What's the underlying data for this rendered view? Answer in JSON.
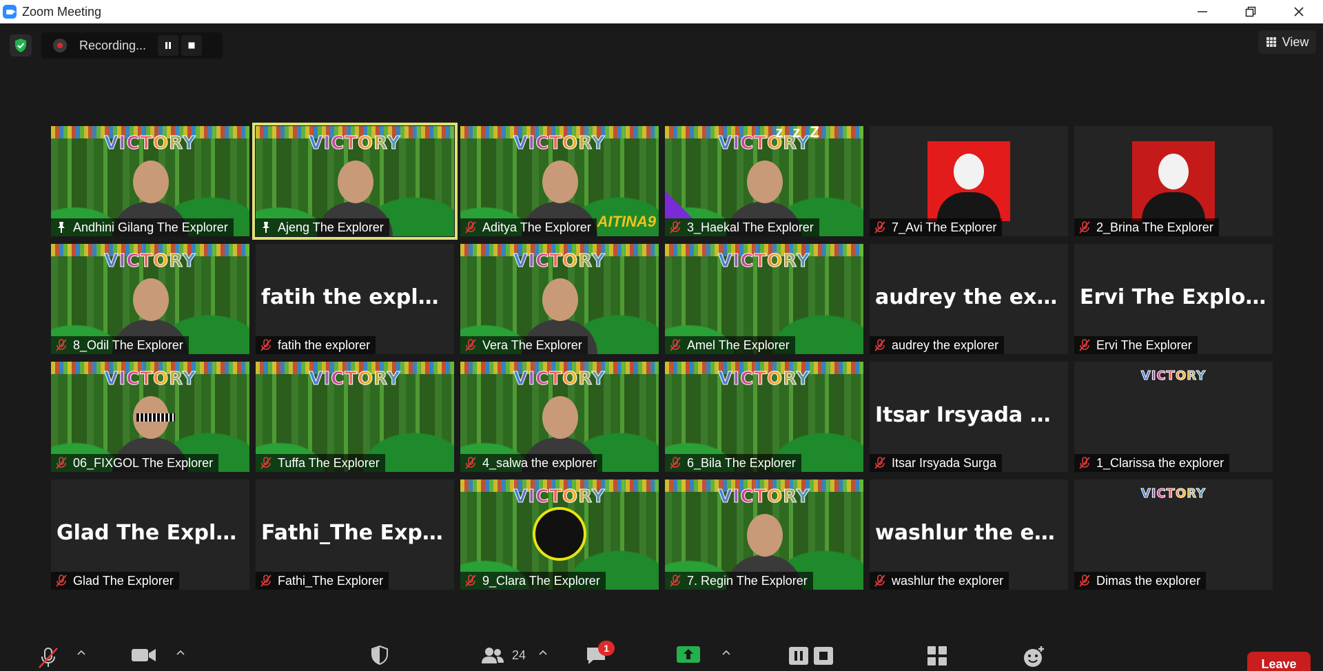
{
  "window": {
    "title": "Zoom Meeting",
    "minimize": "—",
    "restore": "❐",
    "close": "✕"
  },
  "recording": {
    "label": "Recording...",
    "pause_icon": "pause-icon",
    "stop_icon": "stop-icon"
  },
  "view_button": {
    "label": "View"
  },
  "participants": [
    {
      "display": "video",
      "name": "Andhini Gilang The Explorer",
      "mic": "pinned",
      "active": false
    },
    {
      "display": "video",
      "name": "Ajeng The Explorer",
      "mic": "pinned",
      "active": true
    },
    {
      "display": "video",
      "name": "Aditya The Explorer",
      "mic": "muted",
      "active": false,
      "extra": "AITINA9"
    },
    {
      "display": "video",
      "name": "3_Haekal The Explorer",
      "mic": "muted",
      "active": false,
      "extra": "z z Z"
    },
    {
      "display": "photo-red",
      "name": "7_Avi The Explorer",
      "mic": "muted",
      "active": false
    },
    {
      "display": "photo-red2",
      "name": "2_Brina The Explorer",
      "mic": "muted",
      "active": false
    },
    {
      "display": "video",
      "name": "8_Odil The Explorer",
      "mic": "muted",
      "active": false
    },
    {
      "display": "name",
      "name": "fatih the explorer",
      "center_name": "fatih the explorer",
      "mic": "muted",
      "active": false
    },
    {
      "display": "video",
      "name": "Vera The Explorer",
      "mic": "muted",
      "active": false
    },
    {
      "display": "video-empty",
      "name": "Amel The Explorer",
      "mic": "muted",
      "active": false
    },
    {
      "display": "name",
      "name": "audrey the explorer",
      "center_name": "audrey the expl…",
      "mic": "muted",
      "active": false
    },
    {
      "display": "name",
      "name": "Ervi The Explorer",
      "center_name": "Ervi The Explorer",
      "mic": "muted",
      "active": false
    },
    {
      "display": "video",
      "name": "06_FIXGOL The Explorer",
      "mic": "muted",
      "active": false,
      "extra": "glasses"
    },
    {
      "display": "video-empty",
      "name": "Tuffa The Explorer",
      "mic": "muted",
      "active": false
    },
    {
      "display": "video",
      "name": "4_salwa the explorer",
      "mic": "muted",
      "active": false
    },
    {
      "display": "video-empty",
      "name": "6_Bila The Explorer",
      "mic": "muted",
      "active": false
    },
    {
      "display": "name",
      "name": "Itsar Irsyada Surga",
      "center_name": "Itsar Irsyada Su…",
      "mic": "muted",
      "active": false
    },
    {
      "display": "narrow",
      "name": "1_Clarissa the explorer",
      "mic": "muted",
      "active": false
    },
    {
      "display": "name",
      "name": "Glad The Explorer",
      "center_name": "Glad The Explorer",
      "mic": "muted",
      "active": false
    },
    {
      "display": "name",
      "name": "Fathi_The Explorer",
      "center_name": "Fathi_The Explo…",
      "mic": "muted",
      "active": false
    },
    {
      "display": "emblem",
      "name": "9_Clara The Explorer",
      "mic": "muted",
      "active": false
    },
    {
      "display": "video",
      "name": "7. Regin The Explorer",
      "mic": "muted",
      "active": false
    },
    {
      "display": "name",
      "name": "washlur the explorer",
      "center_name": "washlur the exp…",
      "mic": "muted",
      "active": false
    },
    {
      "display": "narrow",
      "name": "Dimas the explorer",
      "mic": "muted",
      "active": false
    }
  ],
  "video_banner": "VICTORY",
  "toolbar": {
    "participants_count": "24",
    "chat_badge": "1",
    "leave_label": "Leave"
  }
}
